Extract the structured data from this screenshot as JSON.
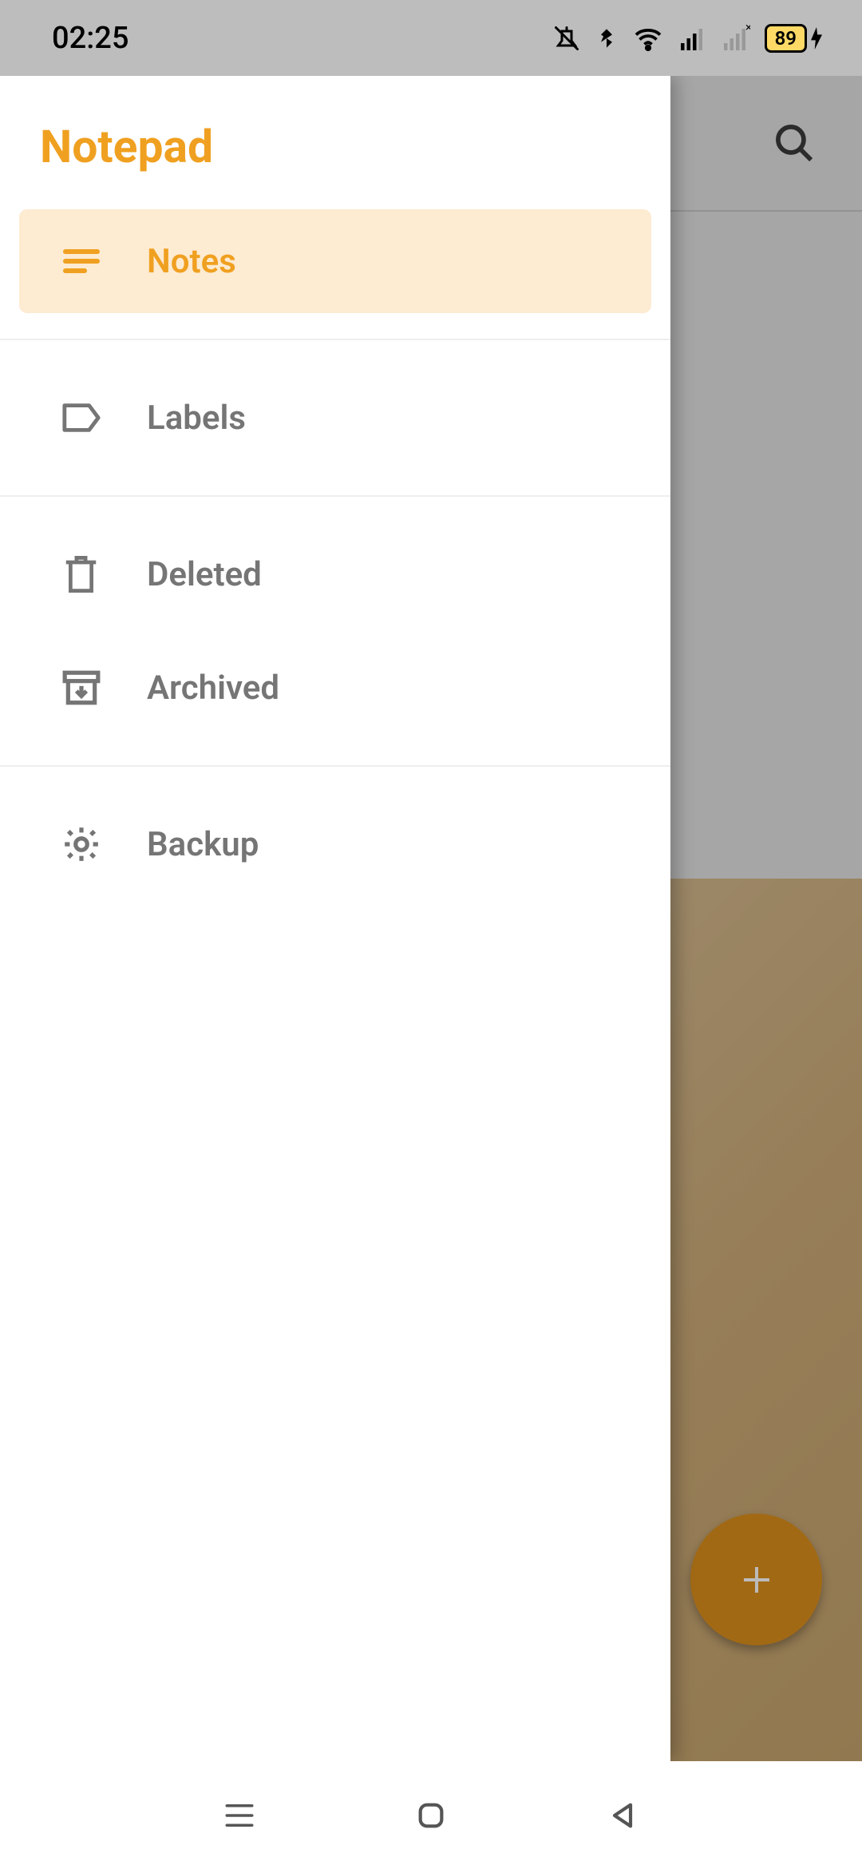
{
  "status_bar": {
    "time": "02:25",
    "battery_percent": "89"
  },
  "drawer": {
    "title": "Notepad",
    "items": [
      {
        "label": "Notes",
        "active": true
      },
      {
        "label": "Labels",
        "active": false
      },
      {
        "label": "Deleted",
        "active": false
      },
      {
        "label": "Archived",
        "active": false
      },
      {
        "label": "Backup",
        "active": false
      }
    ]
  }
}
